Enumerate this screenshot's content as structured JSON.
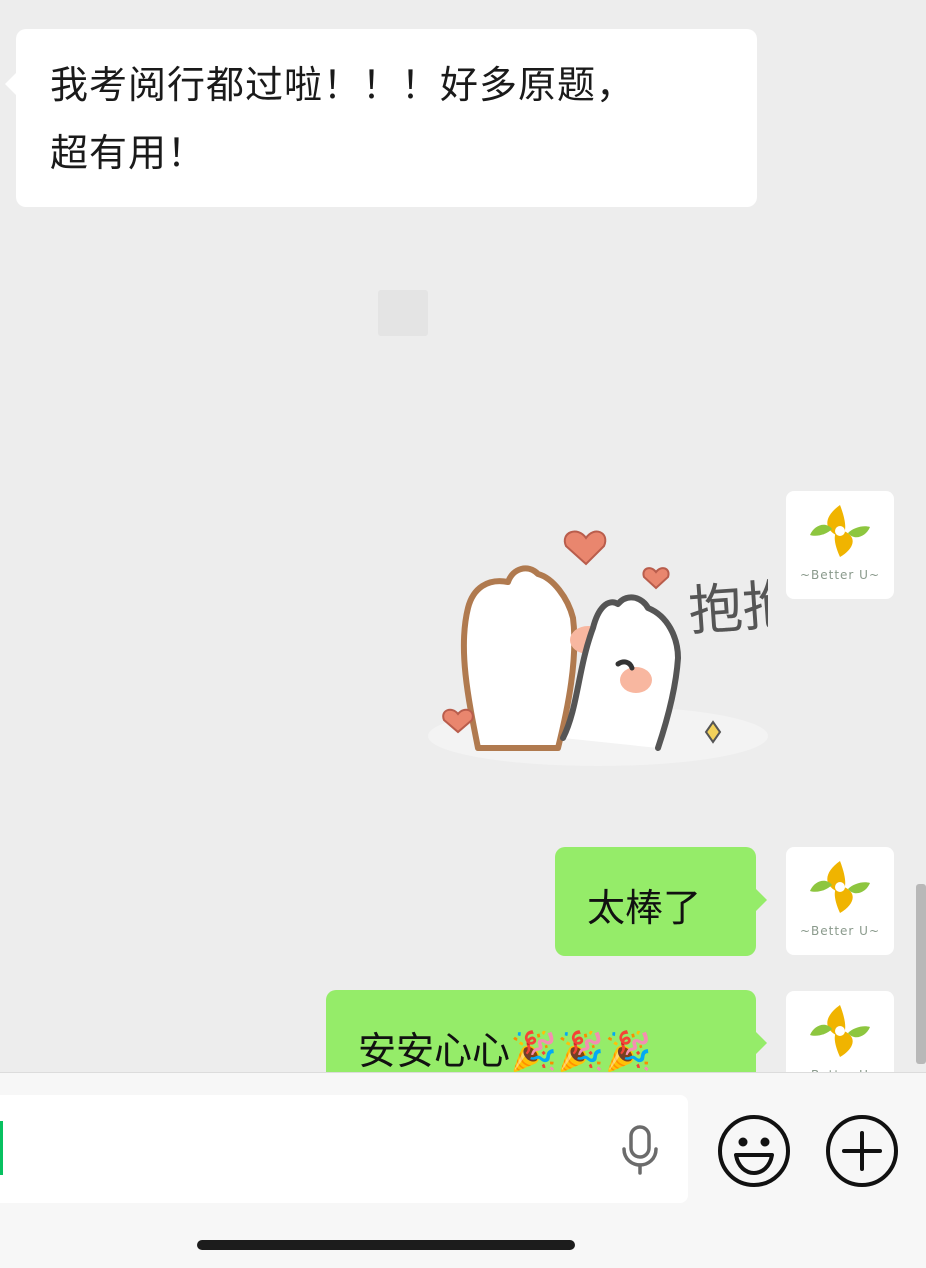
{
  "messages": [
    {
      "side": "incoming",
      "type": "text",
      "text": "我考阅行都过啦！！！好多原题，\n超有用！"
    },
    {
      "side": "outgoing",
      "type": "sticker",
      "sticker_text": "抱抱"
    },
    {
      "side": "outgoing",
      "type": "text",
      "text": "太棒了"
    },
    {
      "side": "outgoing",
      "type": "text",
      "text": "安安心心🎉🎉🎉"
    }
  ],
  "avatar": {
    "logo_text": "~Better U~",
    "icon": "better-u-logo-icon",
    "colors": [
      "#f0b400",
      "#8dc63f"
    ]
  },
  "input": {
    "value": ""
  },
  "icons": {
    "voice": "microphone-icon",
    "emoji": "smiley-icon",
    "more": "plus-icon"
  },
  "colors": {
    "background": "#ededed",
    "outgoing_bubble": "#95ec69",
    "incoming_bubble": "#ffffff",
    "caret": "#07c160"
  }
}
